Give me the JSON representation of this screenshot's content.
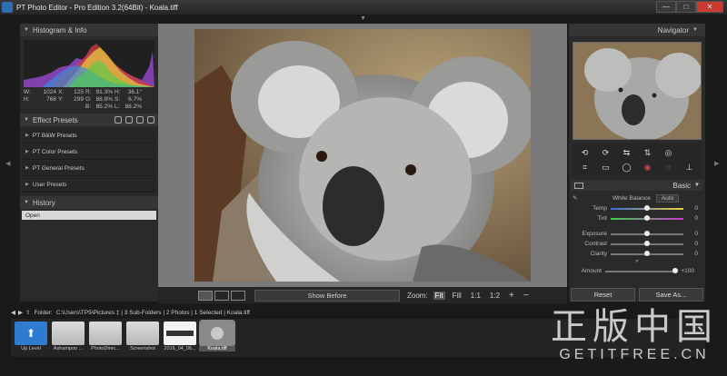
{
  "window": {
    "title": "PT Photo Editor - Pro Edition 3.2(64Bit) - Koala.tiff",
    "minimize": "—",
    "maximize": "□",
    "close": "✕"
  },
  "left": {
    "histogram_title": "Histogram & Info",
    "info": [
      [
        "W:",
        "1024",
        "X:",
        "125",
        "R:",
        "91.3%",
        "H:",
        "36.1°"
      ],
      [
        "H:",
        "768",
        "Y:",
        "299",
        "G:",
        "88.8%",
        "S:",
        "6.7%"
      ],
      [
        "",
        "",
        "",
        "",
        "B:",
        "85.2%",
        "L:",
        "88.2%"
      ]
    ],
    "effect_presets_title": "Effect Presets",
    "presets": [
      "PT B&W Presets",
      "PT Color Presets",
      "PT General Presets",
      "User Presets"
    ],
    "history_title": "History",
    "history_items": [
      "Open"
    ]
  },
  "center": {
    "show_before": "Show Before",
    "zoom_label": "Zoom:",
    "zoom_options": [
      "Fit",
      "Fill",
      "1:1",
      "1:2"
    ],
    "zoom_plus": "+",
    "zoom_minus": "−"
  },
  "right": {
    "navigator_title": "Navigator",
    "basic_title": "Basic",
    "white_balance": "White Balance",
    "auto": "Auto",
    "sliders": [
      {
        "label": "Temp",
        "value": "0",
        "level": 0.5
      },
      {
        "label": "Tint",
        "value": "0",
        "level": 0.5
      },
      {
        "label": "Exposure",
        "value": "0",
        "level": 0.5
      },
      {
        "label": "Contrast",
        "value": "0",
        "level": 0.5
      },
      {
        "label": "Clarity",
        "value": "0",
        "level": 0.5
      }
    ],
    "amount_label": "Amount",
    "amount_value": "+100",
    "reset": "Reset",
    "save_as": "Save As..."
  },
  "folder": {
    "label": "Folder:",
    "path": "C:\\Users\\TP5\\Pictures ‡ | 3 Sub-Folders | 2 Photos | 1 Selected | Koala.tiff"
  },
  "filmstrip": [
    {
      "caption": "Up Level",
      "kind": "up"
    },
    {
      "caption": "Ashampoo ...",
      "kind": "folder"
    },
    {
      "caption": "PhotoDirec...",
      "kind": "folder"
    },
    {
      "caption": "Screenshot",
      "kind": "folder"
    },
    {
      "caption": "2016_04_06...",
      "kind": "image"
    },
    {
      "caption": "Koala.tiff",
      "kind": "koala"
    }
  ],
  "watermark": {
    "big": "正版中国",
    "small": "GETITFREE.CN"
  }
}
